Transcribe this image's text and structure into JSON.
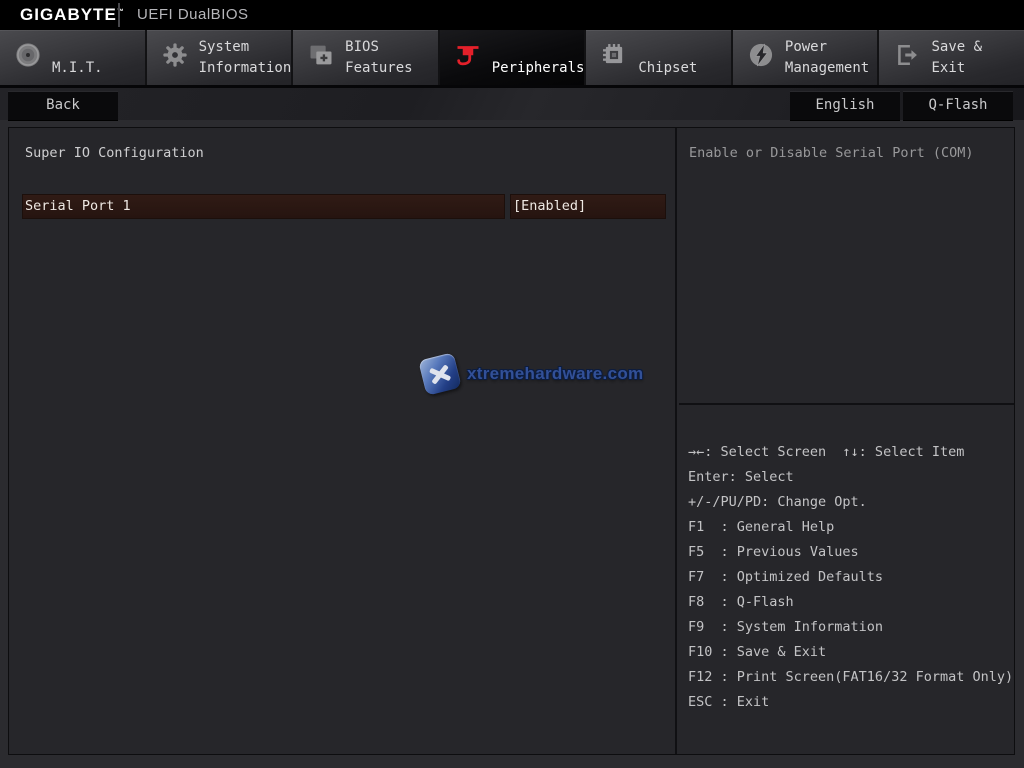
{
  "titlebar": {
    "brand": "GIGABYTE",
    "trademark": "™",
    "title": "UEFI DualBIOS"
  },
  "tabs": [
    {
      "label": "M.I.T.",
      "icon": "mit-dial-icon",
      "selected": false
    },
    {
      "label": "System\nInformation",
      "icon": "system-info-gear-icon",
      "selected": false
    },
    {
      "label": "BIOS\nFeatures",
      "icon": "bios-features-icon",
      "selected": false
    },
    {
      "label": "Peripherals",
      "icon": "peripherals-plug-icon",
      "selected": true
    },
    {
      "label": "Chipset",
      "icon": "chipset-chip-icon",
      "selected": false
    },
    {
      "label": "Power\nManagement",
      "icon": "power-bolt-icon",
      "selected": false
    },
    {
      "label": "Save & Exit",
      "icon": "save-exit-icon",
      "selected": false
    }
  ],
  "toolbar": {
    "back": "Back",
    "language": "English",
    "qflash": "Q-Flash"
  },
  "content": {
    "section_title": "Super IO Configuration",
    "settings": [
      {
        "label": "Serial Port 1",
        "value": "[Enabled]",
        "selected": true
      }
    ],
    "watermark": "xtremehardware.com"
  },
  "help": {
    "description": "Enable or Disable Serial Port (COM)"
  },
  "legend": [
    "→←: Select Screen  ↑↓: Select Item",
    "Enter: Select",
    "+/-/PU/PD: Change Opt.",
    "F1  : General Help",
    "F5  : Previous Values",
    "F7  : Optimized Defaults",
    "F8  : Q-Flash",
    "F9  : System Information",
    "F10 : Save & Exit",
    "F12 : Print Screen(FAT16/32 Format Only)",
    "ESC : Exit"
  ],
  "colors": {
    "accent_red": "#e4202a",
    "selected_row_bg": "#2b1712",
    "panel_bg": "#26262a"
  }
}
